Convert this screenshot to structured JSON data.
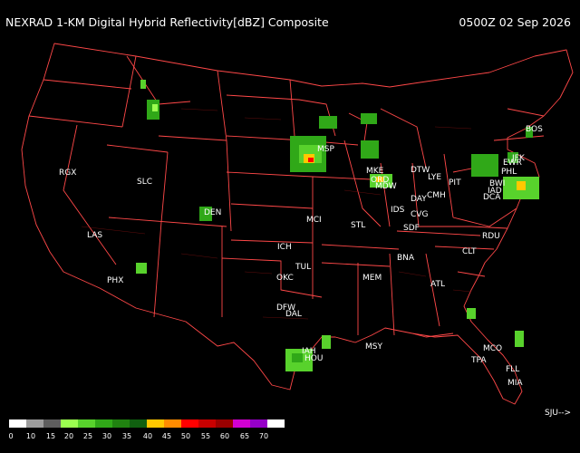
{
  "header": {
    "title": "NEXRAD 1-KM Digital Hybrid Reflectivity[dBZ] Composite",
    "timestamp": "0500Z 02 Sep 2026"
  },
  "stations": [
    {
      "id": "BOS"
    },
    {
      "id": "JFK"
    },
    {
      "id": "EWR"
    },
    {
      "id": "PHL"
    },
    {
      "id": "BWI"
    },
    {
      "id": "IAD"
    },
    {
      "id": "DCA"
    },
    {
      "id": "PIT"
    },
    {
      "id": "LYE"
    },
    {
      "id": "CMH"
    },
    {
      "id": "DAY"
    },
    {
      "id": "CVG"
    },
    {
      "id": "SDF"
    },
    {
      "id": "IDS"
    },
    {
      "id": "DTW"
    },
    {
      "id": "MKE"
    },
    {
      "id": "ORD"
    },
    {
      "id": "MDW"
    },
    {
      "id": "MSP"
    },
    {
      "id": "STL"
    },
    {
      "id": "MCI"
    },
    {
      "id": "DEN"
    },
    {
      "id": "ICH"
    },
    {
      "id": "TUL"
    },
    {
      "id": "OKC"
    },
    {
      "id": "DFW"
    },
    {
      "id": "DAL"
    },
    {
      "id": "IAH"
    },
    {
      "id": "HOU"
    },
    {
      "id": "MSY"
    },
    {
      "id": "MEM"
    },
    {
      "id": "BNA"
    },
    {
      "id": "ATL"
    },
    {
      "id": "CLT"
    },
    {
      "id": "RDU"
    },
    {
      "id": "MCO"
    },
    {
      "id": "TPA"
    },
    {
      "id": "FLL"
    },
    {
      "id": "MIA"
    },
    {
      "id": "SLC"
    },
    {
      "id": "RGX"
    },
    {
      "id": "LAS"
    },
    {
      "id": "PHX"
    }
  ],
  "offmap_label": "SJU-->",
  "legend": {
    "colors": [
      "#ffffff",
      "#9c9c9c",
      "#5e5e5e",
      "#9cff50",
      "#58d22c",
      "#30a818",
      "#208210",
      "#106010",
      "#ffc800",
      "#ff8c00",
      "#ff0000",
      "#c80000",
      "#9a0000",
      "#d200d2",
      "#9600c8",
      "#ffffff"
    ],
    "ticks": [
      "0",
      "10",
      "15",
      "20",
      "25",
      "30",
      "35",
      "40",
      "45",
      "50",
      "55",
      "60",
      "65",
      "70"
    ]
  }
}
